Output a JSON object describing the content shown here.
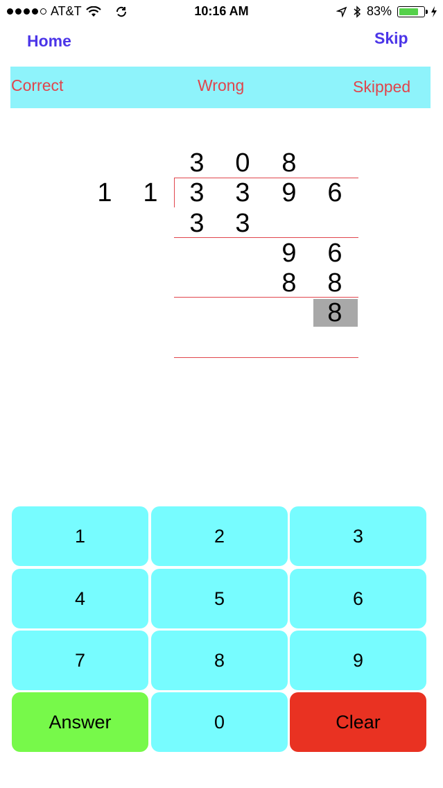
{
  "status_bar": {
    "carrier": "AT&T",
    "time": "10:16 AM",
    "battery_percent": "83%",
    "battery_level": 0.83
  },
  "nav": {
    "home_label": "Home",
    "skip_label": "Skip"
  },
  "score": {
    "correct_label": "Correct",
    "wrong_label": "Wrong",
    "skipped_label": "Skipped"
  },
  "division": {
    "quotient": [
      "3",
      "0",
      "8"
    ],
    "divisor": [
      "1",
      "1"
    ],
    "dividend": [
      "3",
      "3",
      "9",
      "6"
    ],
    "step1_subtract": [
      "3",
      "3"
    ],
    "step2_bringdown": [
      "9",
      "6"
    ],
    "step2_subtract": [
      "8",
      "8"
    ],
    "remainder_input": "8"
  },
  "keypad": {
    "keys": [
      "1",
      "2",
      "3",
      "4",
      "5",
      "6",
      "7",
      "8",
      "9"
    ],
    "answer_label": "Answer",
    "zero_label": "0",
    "clear_label": "Clear"
  },
  "colors": {
    "nav_text": "#4b35e8",
    "score_bg": "#8ef3fb",
    "score_text": "#e0454c",
    "key_bg": "#77fcff",
    "answer_bg": "#77f94a",
    "clear_bg": "#e93222",
    "highlight": "#a8a8a8"
  }
}
